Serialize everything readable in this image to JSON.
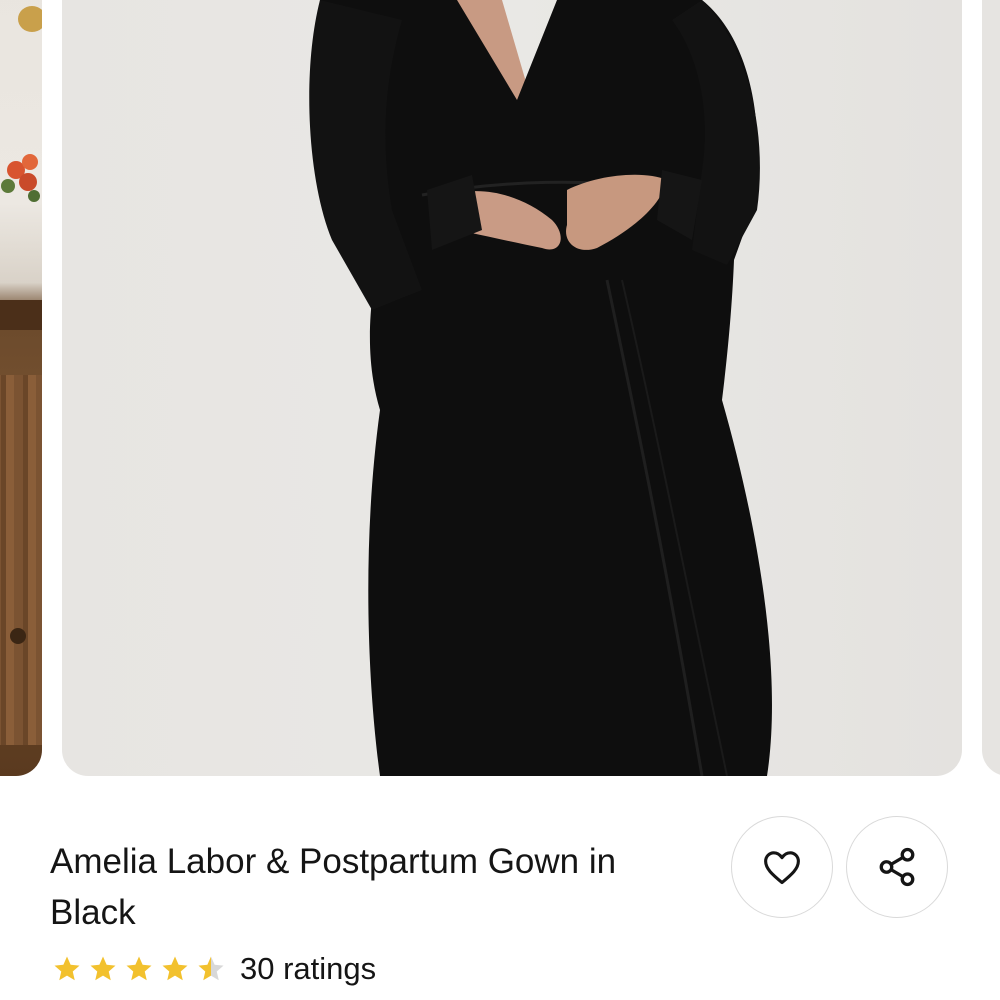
{
  "product": {
    "title": "Amelia Labor & Postpartum Gown in Black",
    "rating_value": 4.5,
    "rating_max": 5,
    "ratings_count_label": "30 ratings",
    "star_color": "#f2c12e",
    "star_empty_color": "#d8d8d8"
  },
  "actions": {
    "wishlist_icon": "heart-outline-icon",
    "share_icon": "share-icon"
  },
  "carousel": {
    "current_image_description_color": "#0d0d0d"
  }
}
